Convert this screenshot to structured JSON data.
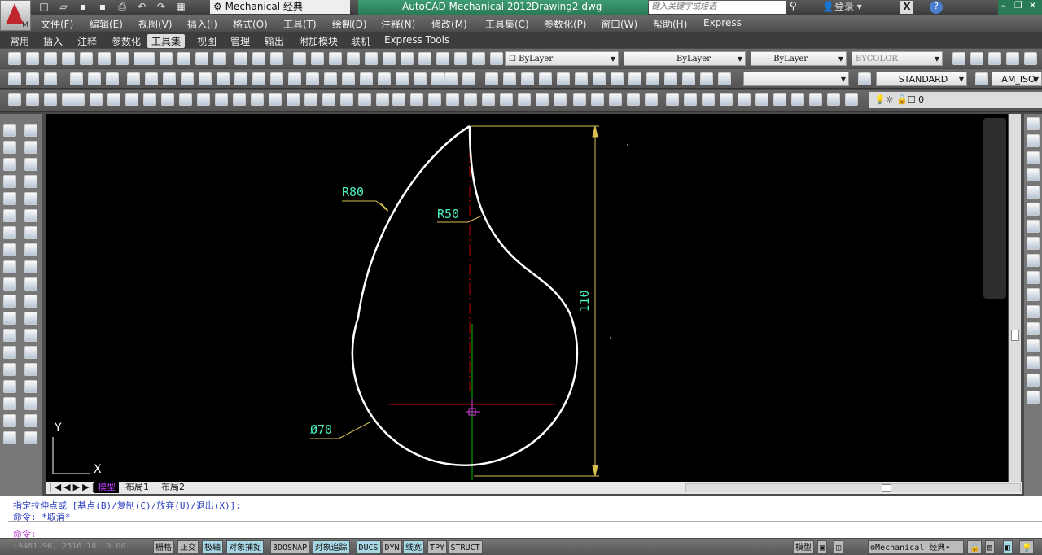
{
  "titlebar": {
    "workspace": "Mechanical 经典",
    "app_title": "AutoCAD Mechanical 2012",
    "file": "Drawing2.dwg",
    "search_placeholder": "键入关键字或短语",
    "login": "登录",
    "quick_access": [
      "new-icon",
      "open-icon",
      "save-icon",
      "saveas-icon",
      "print-icon",
      "undo-icon",
      "redo-icon",
      "workspace-switch-icon"
    ]
  },
  "menubar": [
    "文件(F)",
    "编辑(E)",
    "视图(V)",
    "插入(I)",
    "格式(O)",
    "工具(T)",
    "绘制(D)",
    "注释(N)",
    "修改(M)",
    "工具集(C)",
    "参数化(P)",
    "窗口(W)",
    "帮助(H)",
    "Express"
  ],
  "ribbon_tabs": [
    "常用",
    "插入",
    "注释",
    "参数化",
    "工具集",
    "视图",
    "管理",
    "输出",
    "附加模块",
    "联机",
    "Express Tools"
  ],
  "ribbon_active": "工具集",
  "properties": {
    "color": "ByLayer",
    "linetype": "ByLayer",
    "lineweight": "ByLayer",
    "plotstyle": "BYCOLOR",
    "text_style": "STANDARD",
    "dim_style": "AM_ISO",
    "layer": "0"
  },
  "drawing": {
    "labels": {
      "r80": "R80",
      "r50": "R50",
      "d70": "Ø70",
      "dim": "110"
    },
    "colors": {
      "outline": "#ffffff",
      "dim": "#d8c050",
      "text": "#4cf0c0",
      "center": "#c00000",
      "axis": "#00c000",
      "cursor": "#e040e0"
    },
    "ucs": {
      "x": "X",
      "y": "Y"
    }
  },
  "layout_tabs": [
    "模型",
    "布局1",
    "布局2"
  ],
  "layout_active": "模型",
  "command": {
    "history": [
      "指定拉伸点或 [基点(B)/复制(C)/放弃(U)/退出(X)]:",
      "命令: *取消*"
    ],
    "prompt": "命令:"
  },
  "status": {
    "coords": "-9461.96, 2516.18, 0.00",
    "toggles": [
      {
        "label": "栅格",
        "on": false
      },
      {
        "label": "正交",
        "on": false
      },
      {
        "label": "极轴",
        "on": true
      },
      {
        "label": "对象捕捉",
        "on": true
      },
      {
        "label": "3DOSNAP",
        "on": false
      },
      {
        "label": "对象追踪",
        "on": true
      },
      {
        "label": "DUCS",
        "on": true
      },
      {
        "label": "DYN",
        "on": false
      },
      {
        "label": "线宽",
        "on": true
      },
      {
        "label": "TPY",
        "on": false
      },
      {
        "label": "STRUCT",
        "on": false
      }
    ],
    "model": "模型",
    "workspace": "Mechanical 经典"
  }
}
